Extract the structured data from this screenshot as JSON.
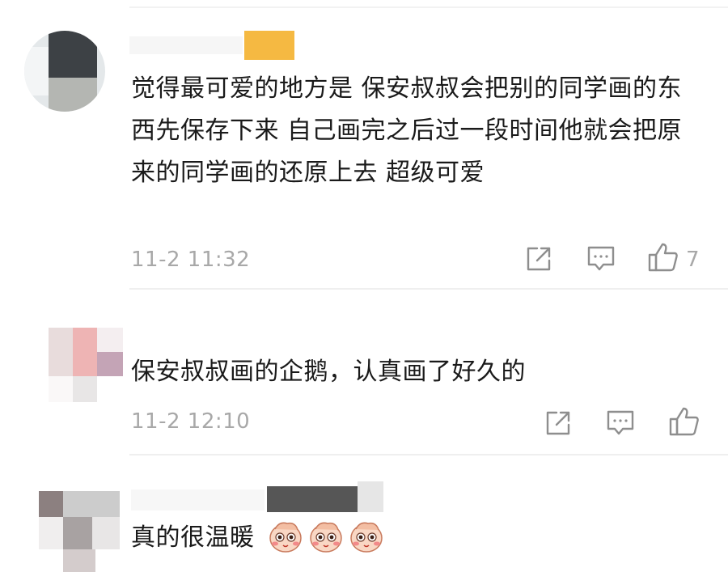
{
  "comments": [
    {
      "text": "觉得最可爱的地方是 保安叔叔会把别的同学画的东西先保存下来 自己画完之后过一段时间他就会把原来的同学画的还原上去 超级可爱",
      "time": "11-2 11:32",
      "like_count": "7"
    },
    {
      "text": "保安叔叔画的企鹅，认真画了好久的",
      "time": "11-2 12:10",
      "like_count": ""
    },
    {
      "text": "真的很温暖",
      "emoji": [
        "shy-face-emoji",
        "shy-face-emoji",
        "shy-face-emoji"
      ]
    }
  ],
  "icons": {
    "share": "share-icon",
    "comment": "comment-icon",
    "like": "thumbs-up-icon"
  },
  "colors": {
    "text": "#1a1a1a",
    "meta": "#a8a8a8",
    "divider": "#efefef",
    "vip_badge": "#f5b942"
  }
}
